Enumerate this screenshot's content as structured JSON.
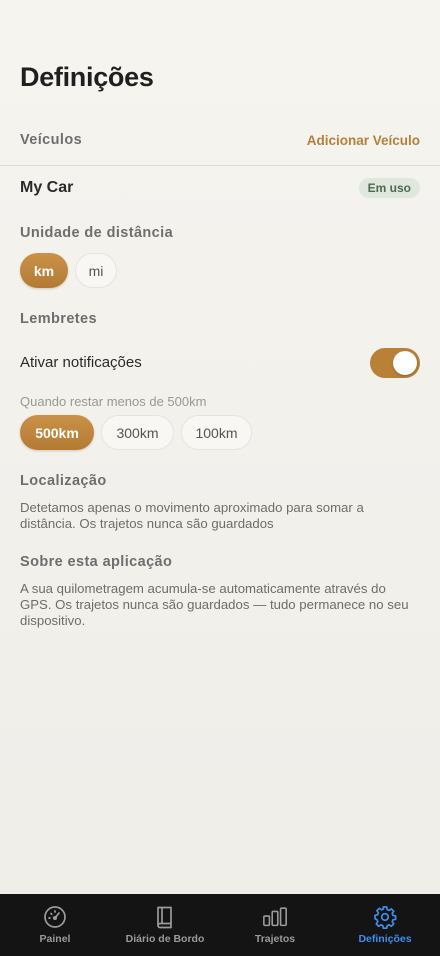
{
  "page": {
    "title": "Definições"
  },
  "vehicles": {
    "section_label": "Veículos",
    "add_label": "Adicionar Veículo",
    "items": [
      {
        "name": "My Car",
        "badge": "Em uso"
      }
    ]
  },
  "distance_unit": {
    "section_label": "Unidade de distância",
    "options": [
      "km",
      "mi"
    ],
    "selected": "km"
  },
  "reminders": {
    "section_label": "Lembretes",
    "notifications_label": "Ativar notificações",
    "notifications_enabled": true,
    "threshold_hint": "Quando restar menos de 500km",
    "threshold_options": [
      "500km",
      "300km",
      "100km"
    ],
    "threshold_selected": "500km"
  },
  "location": {
    "section_label": "Localização",
    "text": "Detetamos apenas o movimento aproximado para somar a distância. Os trajetos nunca são guardados"
  },
  "about": {
    "section_label": "Sobre esta aplicação",
    "text": "A sua quilometragem acumula-se automaticamente através do GPS. Os trajetos nunca são guardados — tudo permanece no seu dispositivo."
  },
  "tabbar": {
    "tabs": [
      {
        "label": "Painel",
        "icon": "gauge-icon"
      },
      {
        "label": "Diário de Bordo",
        "icon": "book-icon"
      },
      {
        "label": "Trajetos",
        "icon": "bar-chart-icon"
      },
      {
        "label": "Definições",
        "icon": "gear-icon"
      }
    ],
    "active": "Definições"
  },
  "colors": {
    "accent": "#b98138",
    "tab_active": "#3d8ef0",
    "tabbar_bg": "#141414",
    "badge_bg": "#e0e7dc",
    "badge_text": "#4c6a52"
  }
}
